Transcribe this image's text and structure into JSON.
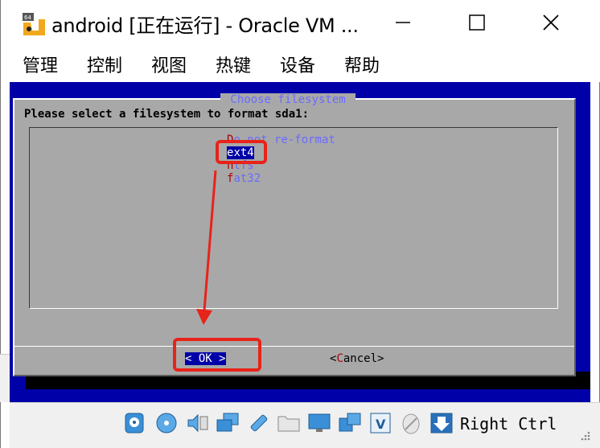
{
  "window": {
    "title": "android [正在运行] - Oracle VM ...",
    "app_icon_badge": "64",
    "minimize_icon": "minimize-icon",
    "maximize_icon": "maximize-icon",
    "close_icon": "close-icon"
  },
  "menubar": {
    "items": [
      "管理",
      "控制",
      "视图",
      "热键",
      "设备",
      "帮助"
    ]
  },
  "vm": {
    "dialog": {
      "title": " Choose filesystem ",
      "prompt": "Please select a filesystem to format sda1:",
      "options": [
        {
          "hot": "D",
          "rest": "o not re-format",
          "selected": false
        },
        {
          "hot": "e",
          "rest": "xt4",
          "selected": true
        },
        {
          "hot": "n",
          "rest": "tfs",
          "selected": false
        },
        {
          "hot": "f",
          "rest": "at32",
          "selected": false
        }
      ],
      "ok_button": {
        "prefix": "< ",
        "hot": "",
        "label": "OK",
        "suffix": " >"
      },
      "cancel_button": {
        "prefix": "<",
        "hot": "C",
        "label": "ancel",
        "suffix": ">"
      }
    },
    "colors": {
      "screen_blue": "#0000a8",
      "dialog_gray": "#a8a8a8",
      "option_text": "#6b6bff",
      "hotkey_red": "#a80000",
      "annotation_red": "#e8231a"
    }
  },
  "statusbar": {
    "icons": [
      "hard-disk-icon",
      "optical-drive-icon",
      "audio-icon",
      "network-icon",
      "usb-icon",
      "shared-folders-icon",
      "display-icon",
      "video-capture-icon",
      "virtualization-icon",
      "mouse-integration-icon",
      "host-key-arrow-icon"
    ],
    "host_key": "Right Ctrl"
  }
}
